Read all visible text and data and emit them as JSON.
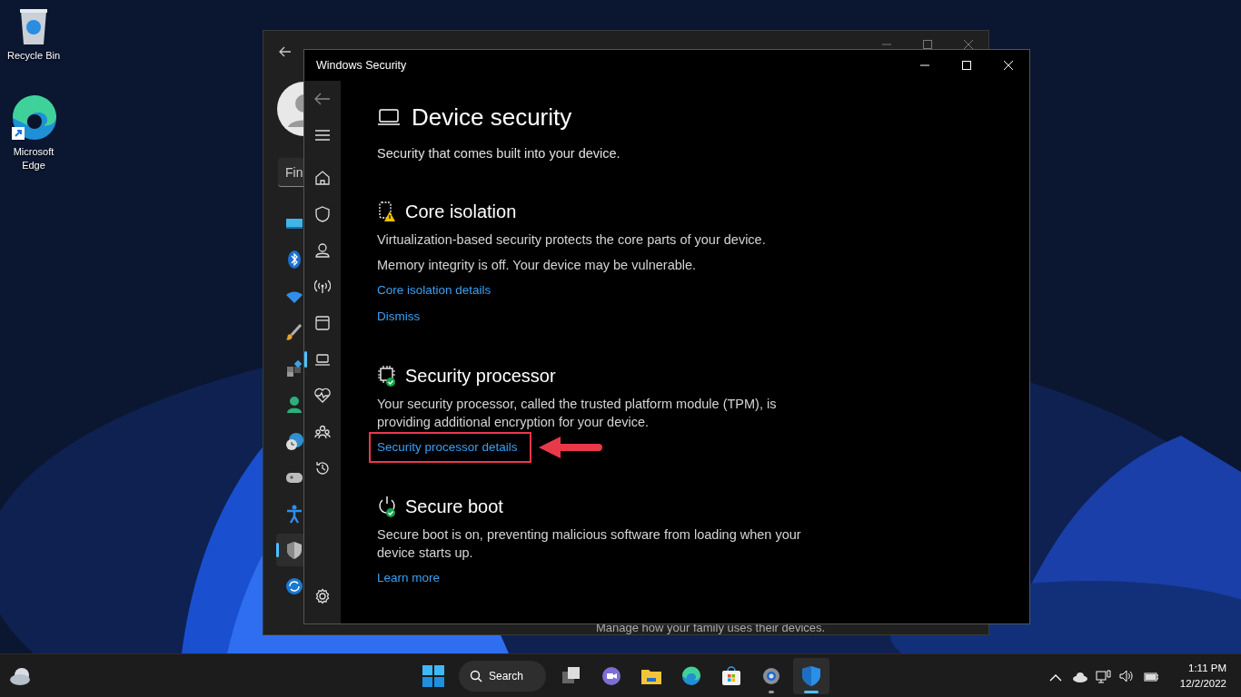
{
  "desktop_icons": [
    {
      "kind": "recycle",
      "label": "Recycle Bin"
    },
    {
      "kind": "edge",
      "label": "Microsoft Edge"
    }
  ],
  "settings_window": {
    "search": {
      "value": "Fin"
    },
    "nav_icons": [
      {
        "kind": "display",
        "selected": false
      },
      {
        "kind": "bluetooth",
        "selected": false
      },
      {
        "kind": "wifi",
        "selected": false
      },
      {
        "kind": "brush",
        "selected": false
      },
      {
        "kind": "apps",
        "selected": false
      },
      {
        "kind": "person",
        "selected": false
      },
      {
        "kind": "time",
        "selected": false
      },
      {
        "kind": "gamepad",
        "selected": false
      },
      {
        "kind": "accessibility",
        "selected": false
      },
      {
        "kind": "shield",
        "selected": true
      },
      {
        "kind": "update",
        "selected": false
      }
    ],
    "footer_text": "Manage how your family uses their devices."
  },
  "security_window": {
    "title": "Windows Security",
    "nav": [
      {
        "kind": "home",
        "selected": false
      },
      {
        "kind": "shield",
        "selected": false
      },
      {
        "kind": "person",
        "selected": false
      },
      {
        "kind": "wireless",
        "selected": false
      },
      {
        "kind": "browser",
        "selected": false
      },
      {
        "kind": "laptop",
        "selected": true
      },
      {
        "kind": "health",
        "selected": false
      },
      {
        "kind": "family",
        "selected": false
      },
      {
        "kind": "history",
        "selected": false
      }
    ],
    "page": {
      "title": "Device security",
      "subtitle": "Security that comes built into your device.",
      "sections": [
        {
          "kind": "warning",
          "title": "Core isolation",
          "paragraphs": [
            "Virtualization-based security protects the core parts of your device.",
            "Memory integrity is off. Your device may be vulnerable."
          ],
          "links": [
            {
              "label": "Core isolation details",
              "highlighted": false
            },
            {
              "label": "Dismiss",
              "highlighted": false
            }
          ]
        },
        {
          "kind": "ok",
          "title": "Security processor",
          "paragraphs": [
            "Your security processor, called the trusted platform module (TPM), is providing additional encryption for your device."
          ],
          "links": [
            {
              "label": "Security processor details",
              "highlighted": true
            }
          ]
        },
        {
          "kind": "ok",
          "title": "Secure boot",
          "paragraphs": [
            "Secure boot is on, preventing malicious software from loading when your device starts up."
          ],
          "links": [
            {
              "label": "Learn more",
              "highlighted": false
            }
          ]
        }
      ]
    }
  },
  "taskbar": {
    "search_label": "Search",
    "apps": [
      {
        "kind": "taskview",
        "running": false,
        "selected": false
      },
      {
        "kind": "teams",
        "running": false,
        "selected": false
      },
      {
        "kind": "explorer",
        "running": false,
        "selected": false
      },
      {
        "kind": "edge",
        "running": false,
        "selected": false
      },
      {
        "kind": "store",
        "running": false,
        "selected": false
      },
      {
        "kind": "settings",
        "running": true,
        "selected": false
      },
      {
        "kind": "security",
        "running": true,
        "selected": true
      }
    ],
    "time": "1:11 PM",
    "date": "12/2/2022"
  }
}
